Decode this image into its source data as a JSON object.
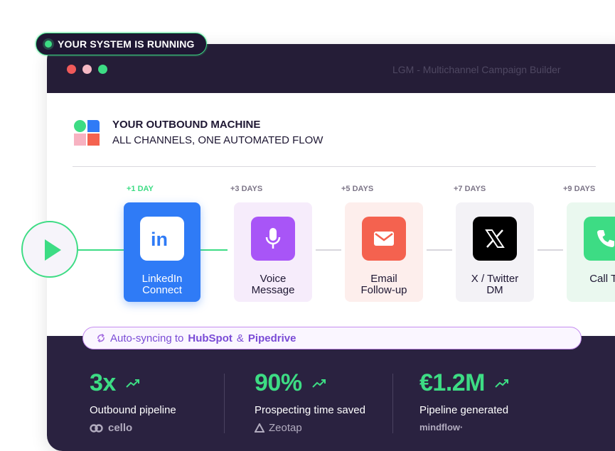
{
  "status": {
    "text": "YOUR SYSTEM IS RUNNING"
  },
  "window": {
    "title": "LGM - Multichannel Campaign Builder"
  },
  "header": {
    "title": "YOUR OUTBOUND MACHINE",
    "subtitle": "ALL CHANNELS, ONE AUTOMATED FLOW"
  },
  "flow": {
    "steps": [
      {
        "day": "+1 DAY",
        "label_line1": "LinkedIn",
        "label_line2": "Connect",
        "icon": "linkedin-icon",
        "color": "#2f7bf6"
      },
      {
        "day": "+3 DAYS",
        "label_line1": "Voice",
        "label_line2": "Message",
        "icon": "microphone-icon",
        "color": "#a855f7"
      },
      {
        "day": "+5 DAYS",
        "label_line1": "Email",
        "label_line2": "Follow-up",
        "icon": "envelope-icon",
        "color": "#f4624f"
      },
      {
        "day": "+7 DAYS",
        "label_line1": "X / Twitter",
        "label_line2": "DM",
        "icon": "x-logo-icon",
        "color": "#000000"
      },
      {
        "day": "+9 DAYS",
        "label_line1": "Call Ta",
        "label_line2": "",
        "icon": "phone-icon",
        "color": "#3ddc84"
      }
    ]
  },
  "sync": {
    "prefix": "Auto-syncing to",
    "crm1": "HubSpot",
    "amp": "&",
    "crm2": "Pipedrive"
  },
  "stats": [
    {
      "value": "3x",
      "label": "Outbound pipeline",
      "brand": "cello"
    },
    {
      "value": "90%",
      "label": "Prospecting time saved",
      "brand": "Zeotap"
    },
    {
      "value": "€1.2M",
      "label": "Pipeline generated",
      "brand": "mindflow·"
    }
  ]
}
